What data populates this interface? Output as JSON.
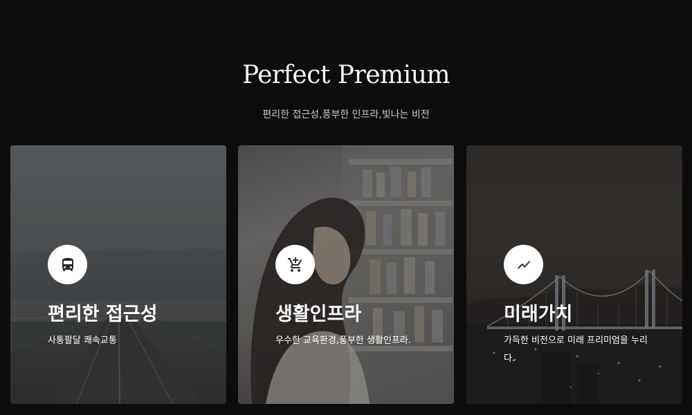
{
  "section": {
    "title": "Perfect Premium",
    "subtitle": "편리한 접근성,풍부한 인프라,빛나는 비전"
  },
  "cards": [
    {
      "icon": "bus-icon",
      "title": "편리한 접근성",
      "description": "사통팔달 쾌속교통"
    },
    {
      "icon": "cart-plus-icon",
      "title": "생활인프라",
      "description": "우수한 교육환경,풍부한 생활인프라."
    },
    {
      "icon": "trending-up-icon",
      "title": "미래가치",
      "description": "가득한 비전으로 미래 프리미엄을 누리다."
    }
  ],
  "colors": {
    "background": "#0d0d0d",
    "icon_circle": "#ffffff",
    "icon_glyph": "#2b2b2b",
    "text": "#ffffff"
  }
}
